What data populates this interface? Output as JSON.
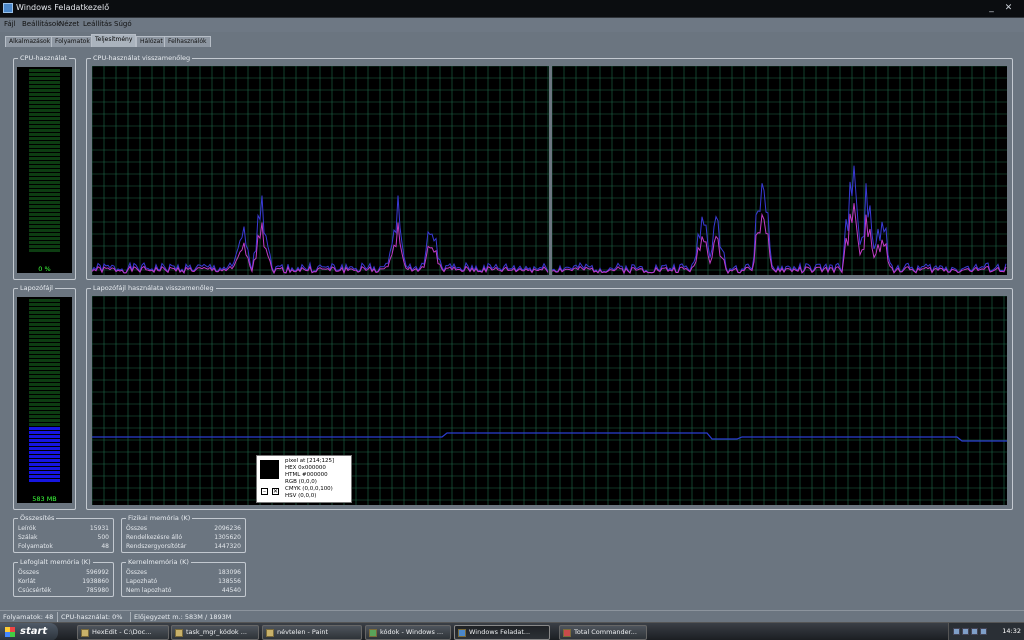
{
  "window": {
    "title": "Windows Feladatkezelő",
    "controls": [
      "_",
      "✕"
    ]
  },
  "menu": [
    "Fájl",
    "Beállítások",
    "Nézet",
    "Leállítás",
    "Súgó"
  ],
  "tabs": [
    {
      "label": "Alkalmazások",
      "active": false
    },
    {
      "label": "Folyamatok",
      "active": false
    },
    {
      "label": "Teljesítmény",
      "active": true
    },
    {
      "label": "Hálózat",
      "active": false
    },
    {
      "label": "Felhasználók",
      "active": false
    }
  ],
  "cpu_meter": {
    "title": "CPU-használat",
    "value": "0 %",
    "fill_fraction": 0.0
  },
  "cpu_history": {
    "title": "CPU-használat visszamenőleg"
  },
  "pf_meter": {
    "title": "Lapozófájl",
    "value": "583 MB",
    "fill_fraction": 0.31
  },
  "pf_history": {
    "title": "Lapozófájl használata visszamenőleg"
  },
  "totals": {
    "title": "Összesítés",
    "rows": [
      {
        "label": "Leírók",
        "value": "15931"
      },
      {
        "label": "Szálak",
        "value": "500"
      },
      {
        "label": "Folyamatok",
        "value": "48"
      }
    ]
  },
  "physical_memory": {
    "title": "Fizikai memória (K)",
    "rows": [
      {
        "label": "Összes",
        "value": "2096236"
      },
      {
        "label": "Rendelkezésre álló",
        "value": "1305620"
      },
      {
        "label": "Rendszergyorsítótár",
        "value": "1447320"
      }
    ]
  },
  "commit_charge": {
    "title": "Lefoglalt memória (K)",
    "rows": [
      {
        "label": "Összes",
        "value": "596992"
      },
      {
        "label": "Korlát",
        "value": "1938860"
      },
      {
        "label": "Csúcsérték",
        "value": "785980"
      }
    ]
  },
  "kernel_memory": {
    "title": "Kernelmemória (K)",
    "rows": [
      {
        "label": "Összes",
        "value": "183096"
      },
      {
        "label": "Lapozható",
        "value": "138556"
      },
      {
        "label": "Nem lapozható",
        "value": "44540"
      }
    ]
  },
  "picker": {
    "lines": [
      "pixel at [214;125]",
      "HEX 0x000000",
      "HTML #000000",
      "RGB (0,0,0)",
      "CMYK (0,0,0,100)",
      "HSV (0,0,0)"
    ],
    "swatch_color": "#000000",
    "btn_minus": "–",
    "btn_close": "✕"
  },
  "statusbar": {
    "processes": "Folyamatok: 48",
    "cpu": "CPU-használat: 0%",
    "commit": "Előjegyzett m.: 583M / 1893M"
  },
  "taskbar": {
    "start": "start",
    "tasks": [
      {
        "label": "HexEdit - C:\\Doc...",
        "active": false
      },
      {
        "label": "task_mgr_kódok ...",
        "active": false
      },
      {
        "label": "névtelen - Paint",
        "active": false
      },
      {
        "label": "kódok - Windows ...",
        "active": false
      },
      {
        "label": "Windows Feladat...",
        "active": true
      },
      {
        "label": "Total Commander...",
        "active": false
      }
    ],
    "clock": "14:32"
  },
  "colors": {
    "grid": "#1f6b4a",
    "cpu_kernel": "#c23cc8",
    "cpu_user": "#3a3ad6",
    "meter_fill": "#1616e0",
    "meter_text": "#3cff3c"
  }
}
